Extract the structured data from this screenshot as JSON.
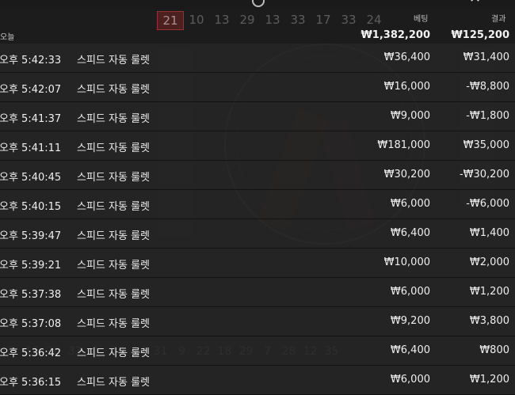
{
  "background": {
    "top_numbers": [
      "21",
      "10",
      "13",
      "29",
      "13",
      "33",
      "17",
      "33",
      "24"
    ],
    "bottom_numbers": [
      "2",
      "16",
      "26",
      "33",
      "1",
      "20",
      "14",
      "31",
      "9",
      "22",
      "18",
      "29",
      "7",
      "28",
      "12",
      "35"
    ]
  },
  "header": {
    "bet_label": "베팅",
    "result_label": "결과",
    "today_label": "오늘",
    "total_bet": "₩1,382,200",
    "total_result": "₩125,200"
  },
  "rows": [
    {
      "time": "오후 5:42:33",
      "game": "스피드 자동 룰렛",
      "bet": "₩36,400",
      "result": "₩31,400"
    },
    {
      "time": "오후 5:42:07",
      "game": "스피드 자동 룰렛",
      "bet": "₩16,000",
      "result": "-₩8,800"
    },
    {
      "time": "오후 5:41:37",
      "game": "스피드 자동 룰렛",
      "bet": "₩9,000",
      "result": "-₩1,800"
    },
    {
      "time": "오후 5:41:11",
      "game": "스피드 자동 룰렛",
      "bet": "₩181,000",
      "result": "₩35,000"
    },
    {
      "time": "오후 5:40:45",
      "game": "스피드 자동 룰렛",
      "bet": "₩30,200",
      "result": "-₩30,200"
    },
    {
      "time": "오후 5:40:15",
      "game": "스피드 자동 룰렛",
      "bet": "₩6,000",
      "result": "-₩6,000"
    },
    {
      "time": "오후 5:39:47",
      "game": "스피드 자동 룰렛",
      "bet": "₩6,400",
      "result": "₩1,400"
    },
    {
      "time": "오후 5:39:21",
      "game": "스피드 자동 룰렛",
      "bet": "₩10,000",
      "result": "₩2,000"
    },
    {
      "time": "오후 5:37:38",
      "game": "스피드 자동 룰렛",
      "bet": "₩6,000",
      "result": "₩1,200"
    },
    {
      "time": "오후 5:37:08",
      "game": "스피드 자동 룰렛",
      "bet": "₩9,200",
      "result": "₩3,800"
    },
    {
      "time": "오후 5:36:42",
      "game": "스피드 자동 룰렛",
      "bet": "₩6,400",
      "result": "₩800"
    },
    {
      "time": "오후 5:36:15",
      "game": "스피드 자동 룰렛",
      "bet": "₩6,000",
      "result": "₩1,200"
    }
  ]
}
